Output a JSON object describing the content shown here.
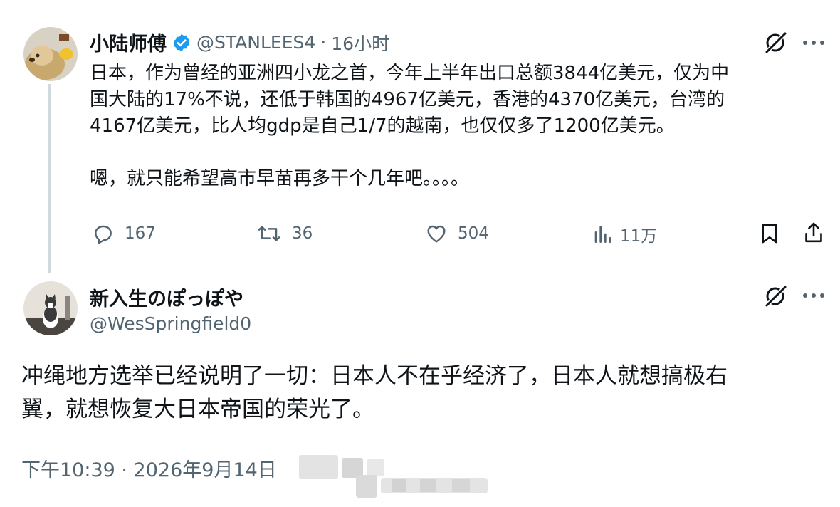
{
  "tweet": {
    "author_name": "小陆师傅",
    "handle": "@STANLEES4",
    "separator": "·",
    "time": "16小时",
    "lines": [
      "日本，作为曾经的亚洲四小龙之首，今年上半年出口总额3844亿美元，仅为中",
      "国大陆的17%不说，还低于韩国的4967亿美元，香港的4370亿美元，台湾的",
      "4167亿美元，比人均gdp是自己1/7的越南，也仅仅多了1200亿美元。"
    ],
    "line_last": "嗯，就只能希望高市早苗再多干个几年吧。。。。",
    "stats": {
      "replies": "167",
      "retweets": "36",
      "likes": "504",
      "views": "11万"
    }
  },
  "reply": {
    "author_name": "新入生のぽっぽや",
    "handle": "@WesSpringfield0",
    "lines": [
      "冲绳地方选举已经说明了一切：日本人不在乎经济了，日本人就想搞极右",
      "翼，就想恢复大日本帝国的荣光了。"
    ],
    "timestamp": "下午10:39 · 2026年9月14日"
  },
  "colors": {
    "text": "#0f1419",
    "secondary": "#536471",
    "verified": "#1d9bf0",
    "thread_line": "#cfd9de"
  },
  "icons": [
    "verified-badge-icon",
    "grok-icon",
    "more-icon",
    "reply-icon",
    "retweet-icon",
    "like-icon",
    "views-icon",
    "bookmark-icon",
    "share-icon"
  ]
}
